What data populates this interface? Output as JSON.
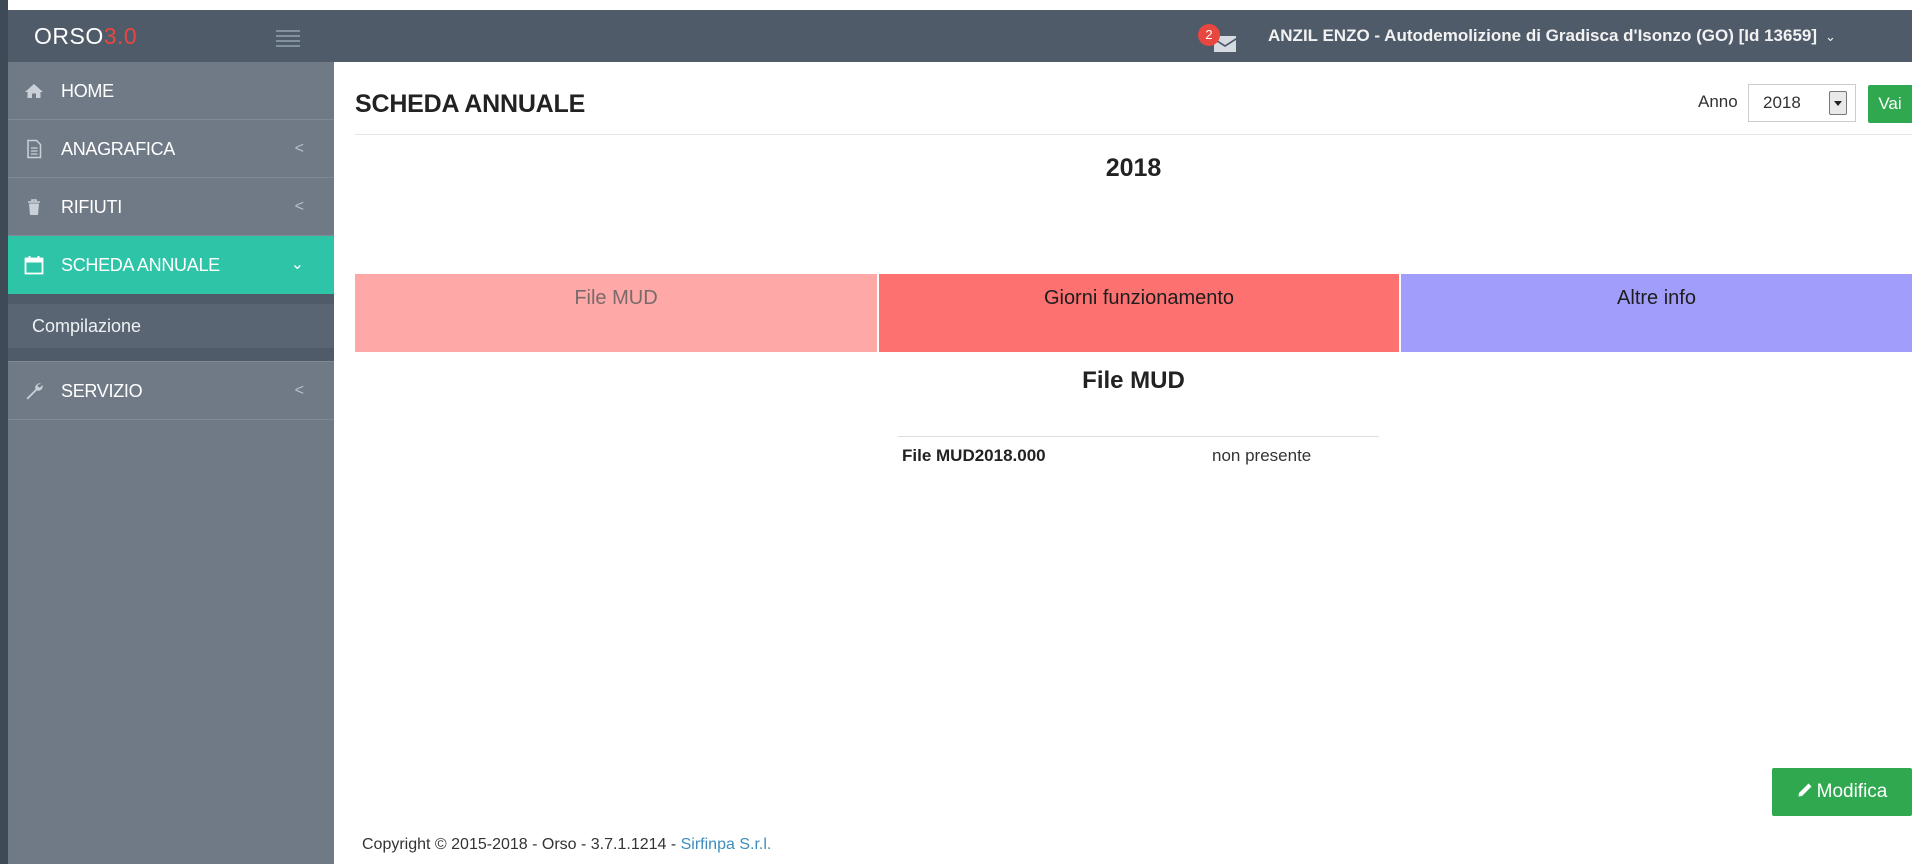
{
  "header": {
    "logo_main": "ORSO",
    "logo_version": "3.0",
    "notification_count": "2",
    "user_label": "ANZIL ENZO - Autodemolizione di Gradisca d'Isonzo (GO) [Id 13659]",
    "user_caret": "⌄"
  },
  "sidebar": {
    "items": [
      {
        "label": "HOME",
        "icon": "home-icon"
      },
      {
        "label": "ANAGRAFICA",
        "icon": "document-icon",
        "chevron": "<"
      },
      {
        "label": "RIFIUTI",
        "icon": "trash-icon",
        "chevron": "<"
      },
      {
        "label": "SCHEDA ANNUALE",
        "icon": "calendar-icon",
        "chevron": "⌄"
      },
      {
        "label": "SERVIZIO",
        "icon": "wrench-icon",
        "chevron": "<"
      }
    ],
    "submenu": [
      {
        "label": "Compilazione"
      }
    ]
  },
  "main": {
    "title": "SCHEDA ANNUALE",
    "anno_label": "Anno",
    "anno_selected": "2018",
    "vai_label": "Vai",
    "year_heading": "2018",
    "tabs": [
      {
        "label": "File MUD",
        "color": "#fea8a8"
      },
      {
        "label": "Giorni funzionamento",
        "color": "#fd7171"
      },
      {
        "label": "Altre info",
        "color": "#a09dfb"
      }
    ],
    "section_heading": "File MUD",
    "mud_rows": [
      {
        "key": "File MUD2018.000",
        "value": "non presente"
      }
    ],
    "modifica_label": "Modifica"
  },
  "footer": {
    "text": "Copyright © 2015-2018 - Orso - 3.7.1.1214 - ",
    "link": "Sirfinpa S.r.l."
  },
  "colors": {
    "header_bg": "#4f5b69",
    "sidebar_bg": "#6f7a86",
    "active_item": "#2ec4a7",
    "button_green": "#2fa84f",
    "logo_accent": "#e8473f"
  }
}
